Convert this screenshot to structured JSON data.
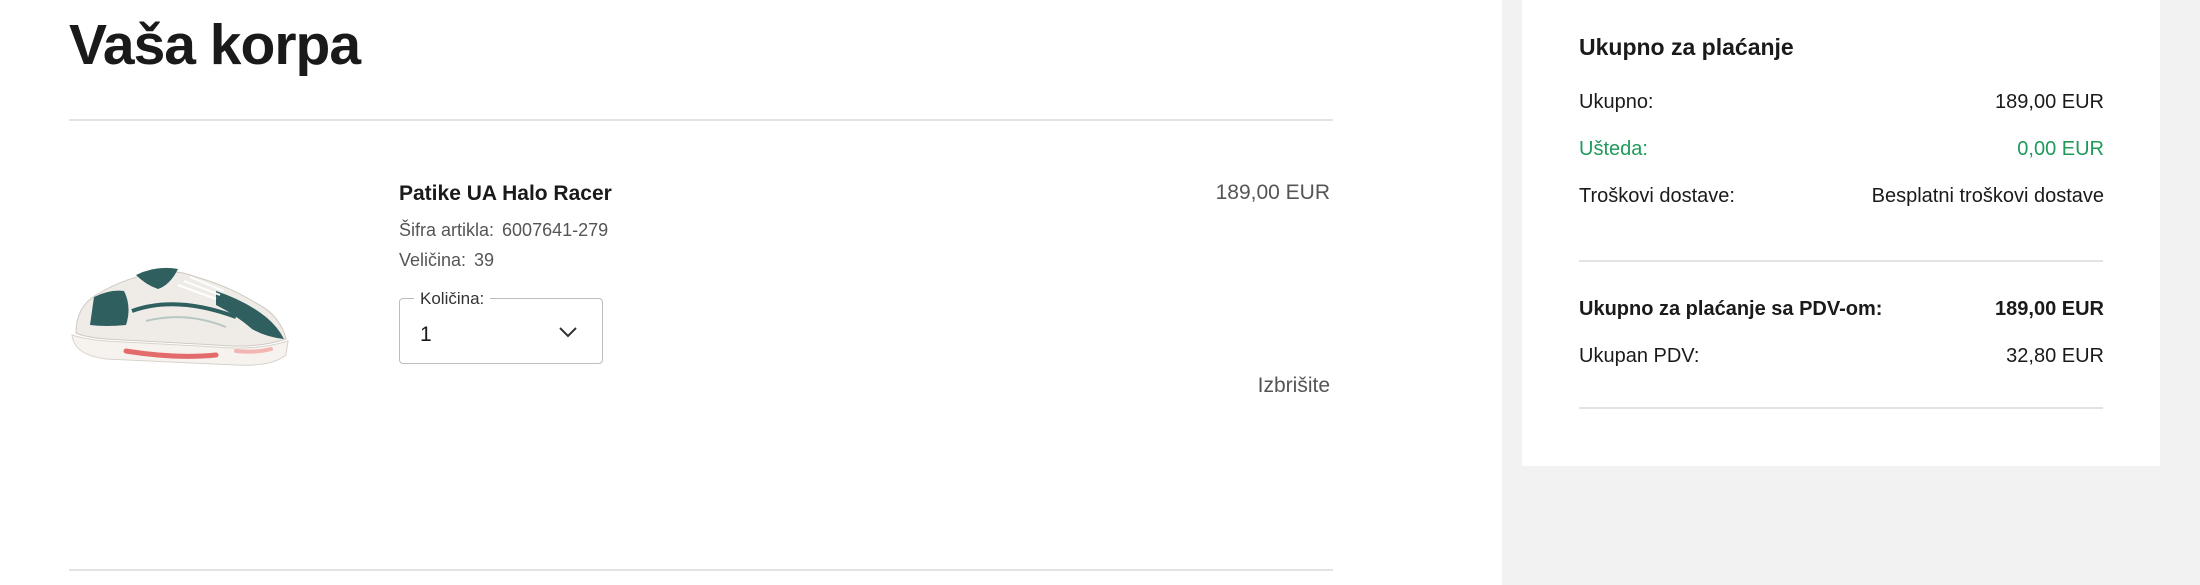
{
  "page": {
    "title": "Vaša korpa"
  },
  "cart": {
    "items": [
      {
        "name": "Patike UA Halo Racer",
        "price": "189,00 EUR",
        "sku_label": "Šifra artikla:",
        "sku": "6007641-279",
        "size_label": "Veličina:",
        "size": "39",
        "quantity_label": "Količina:",
        "quantity": "1",
        "delete_label": "Izbrišite",
        "image_icon": "sneaker-image"
      }
    ]
  },
  "summary": {
    "title": "Ukupno za plaćanje",
    "subtotal_label": "Ukupno:",
    "subtotal": "189,00 EUR",
    "savings_label": "Ušteda:",
    "savings": "0,00 EUR",
    "shipping_label": "Troškovi dostave:",
    "shipping": "Besplatni troškovi dostave",
    "total_label": "Ukupno za plaćanje sa PDV-om:",
    "total": "189,00 EUR",
    "vat_label": "Ukupan PDV:",
    "vat": "32,80 EUR"
  },
  "colors": {
    "savings": "#1f9a5b",
    "sidebar_bg": "#f2f2f2",
    "divider": "#e3e3e3"
  }
}
